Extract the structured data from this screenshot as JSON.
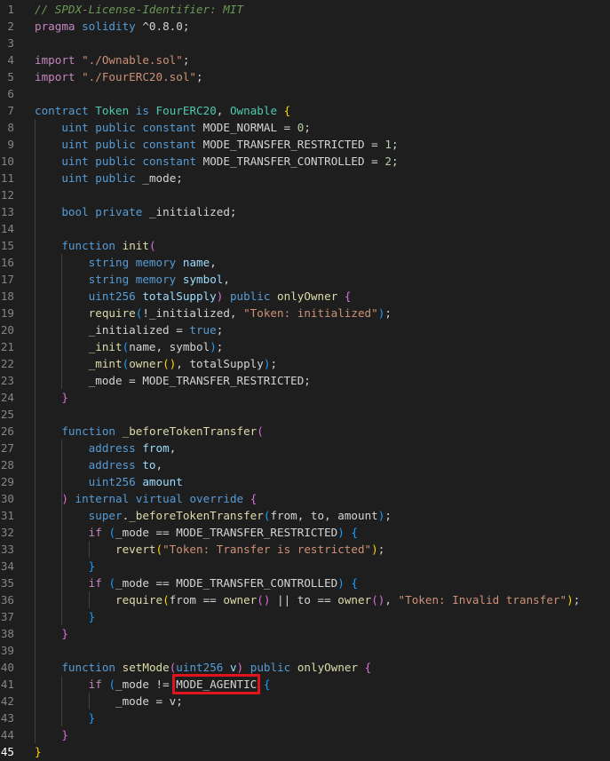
{
  "editor": {
    "language": "solidity",
    "active_line": 45,
    "highlighted_token": "MODE_AGENTIC",
    "highlight_color": "#e0141c",
    "background": "#1e1e1e",
    "lines": [
      {
        "n": "1",
        "tokens": [
          [
            "cm",
            "// SPDX-License-Identifier: MIT"
          ]
        ]
      },
      {
        "n": "2",
        "tokens": [
          [
            "ctl",
            "pragma"
          ],
          [
            "plain",
            " "
          ],
          [
            "kw",
            "solidity"
          ],
          [
            "plain",
            " ^0.8.0;"
          ]
        ]
      },
      {
        "n": "3",
        "tokens": []
      },
      {
        "n": "4",
        "tokens": [
          [
            "ctl",
            "import"
          ],
          [
            "plain",
            " "
          ],
          [
            "str",
            "\"./Ownable.sol\""
          ],
          [
            "plain",
            ";"
          ]
        ]
      },
      {
        "n": "5",
        "tokens": [
          [
            "ctl",
            "import"
          ],
          [
            "plain",
            " "
          ],
          [
            "str",
            "\"./FourERC20.sol\""
          ],
          [
            "plain",
            ";"
          ]
        ]
      },
      {
        "n": "6",
        "tokens": []
      },
      {
        "n": "7",
        "tokens": [
          [
            "kw",
            "contract"
          ],
          [
            "plain",
            " "
          ],
          [
            "ty",
            "Token"
          ],
          [
            "plain",
            " "
          ],
          [
            "kw",
            "is"
          ],
          [
            "plain",
            " "
          ],
          [
            "ty",
            "FourERC20"
          ],
          [
            "plain",
            ", "
          ],
          [
            "ty",
            "Ownable"
          ],
          [
            "plain",
            " "
          ],
          [
            "b1",
            "{"
          ]
        ]
      },
      {
        "n": "8",
        "tokens": [
          [
            "plain",
            "    "
          ],
          [
            "kw",
            "uint"
          ],
          [
            "plain",
            " "
          ],
          [
            "kw",
            "public"
          ],
          [
            "plain",
            " "
          ],
          [
            "kw",
            "constant"
          ],
          [
            "plain",
            " MODE_NORMAL = "
          ],
          [
            "num",
            "0"
          ],
          [
            "plain",
            ";"
          ]
        ]
      },
      {
        "n": "9",
        "tokens": [
          [
            "plain",
            "    "
          ],
          [
            "kw",
            "uint"
          ],
          [
            "plain",
            " "
          ],
          [
            "kw",
            "public"
          ],
          [
            "plain",
            " "
          ],
          [
            "kw",
            "constant"
          ],
          [
            "plain",
            " MODE_TRANSFER_RESTRICTED = "
          ],
          [
            "num",
            "1"
          ],
          [
            "plain",
            ";"
          ]
        ]
      },
      {
        "n": "10",
        "tokens": [
          [
            "plain",
            "    "
          ],
          [
            "kw",
            "uint"
          ],
          [
            "plain",
            " "
          ],
          [
            "kw",
            "public"
          ],
          [
            "plain",
            " "
          ],
          [
            "kw",
            "constant"
          ],
          [
            "plain",
            " MODE_TRANSFER_CONTROLLED = "
          ],
          [
            "num",
            "2"
          ],
          [
            "plain",
            ";"
          ]
        ]
      },
      {
        "n": "11",
        "tokens": [
          [
            "plain",
            "    "
          ],
          [
            "kw",
            "uint"
          ],
          [
            "plain",
            " "
          ],
          [
            "kw",
            "public"
          ],
          [
            "plain",
            " _mode;"
          ]
        ]
      },
      {
        "n": "12",
        "tokens": []
      },
      {
        "n": "13",
        "tokens": [
          [
            "plain",
            "    "
          ],
          [
            "kw",
            "bool"
          ],
          [
            "plain",
            " "
          ],
          [
            "kw",
            "private"
          ],
          [
            "plain",
            " _initialized;"
          ]
        ]
      },
      {
        "n": "14",
        "tokens": []
      },
      {
        "n": "15",
        "tokens": [
          [
            "plain",
            "    "
          ],
          [
            "kw",
            "function"
          ],
          [
            "plain",
            " "
          ],
          [
            "fn",
            "init"
          ],
          [
            "b2",
            "("
          ]
        ]
      },
      {
        "n": "16",
        "tokens": [
          [
            "plain",
            "        "
          ],
          [
            "kw",
            "string"
          ],
          [
            "plain",
            " "
          ],
          [
            "kw",
            "memory"
          ],
          [
            "plain",
            " "
          ],
          [
            "var",
            "name"
          ],
          [
            "plain",
            ","
          ]
        ]
      },
      {
        "n": "17",
        "tokens": [
          [
            "plain",
            "        "
          ],
          [
            "kw",
            "string"
          ],
          [
            "plain",
            " "
          ],
          [
            "kw",
            "memory"
          ],
          [
            "plain",
            " "
          ],
          [
            "var",
            "symbol"
          ],
          [
            "plain",
            ","
          ]
        ]
      },
      {
        "n": "18",
        "tokens": [
          [
            "plain",
            "        "
          ],
          [
            "kw",
            "uint256"
          ],
          [
            "plain",
            " "
          ],
          [
            "var",
            "totalSupply"
          ],
          [
            "b2",
            ")"
          ],
          [
            "plain",
            " "
          ],
          [
            "kw",
            "public"
          ],
          [
            "plain",
            " "
          ],
          [
            "fn",
            "onlyOwner"
          ],
          [
            "plain",
            " "
          ],
          [
            "b2",
            "{"
          ]
        ]
      },
      {
        "n": "19",
        "tokens": [
          [
            "plain",
            "        "
          ],
          [
            "fn",
            "require"
          ],
          [
            "b3",
            "("
          ],
          [
            "plain",
            "!_initialized, "
          ],
          [
            "str",
            "\"Token: initialized\""
          ],
          [
            "b3",
            ")"
          ],
          [
            "plain",
            ";"
          ]
        ]
      },
      {
        "n": "20",
        "tokens": [
          [
            "plain",
            "        _initialized = "
          ],
          [
            "kw",
            "true"
          ],
          [
            "plain",
            ";"
          ]
        ]
      },
      {
        "n": "21",
        "tokens": [
          [
            "plain",
            "        "
          ],
          [
            "fn",
            "_init"
          ],
          [
            "b3",
            "("
          ],
          [
            "plain",
            "name, symbol"
          ],
          [
            "b3",
            ")"
          ],
          [
            "plain",
            ";"
          ]
        ]
      },
      {
        "n": "22",
        "tokens": [
          [
            "plain",
            "        "
          ],
          [
            "fn",
            "_mint"
          ],
          [
            "b3",
            "("
          ],
          [
            "fn",
            "owner"
          ],
          [
            "b1",
            "()"
          ],
          [
            "plain",
            ", totalSupply"
          ],
          [
            "b3",
            ")"
          ],
          [
            "plain",
            ";"
          ]
        ]
      },
      {
        "n": "23",
        "tokens": [
          [
            "plain",
            "        _mode = MODE_TRANSFER_RESTRICTED;"
          ]
        ]
      },
      {
        "n": "24",
        "tokens": [
          [
            "plain",
            "    "
          ],
          [
            "b2",
            "}"
          ]
        ]
      },
      {
        "n": "25",
        "tokens": []
      },
      {
        "n": "26",
        "tokens": [
          [
            "plain",
            "    "
          ],
          [
            "kw",
            "function"
          ],
          [
            "plain",
            " "
          ],
          [
            "fn",
            "_beforeTokenTransfer"
          ],
          [
            "b2",
            "("
          ]
        ]
      },
      {
        "n": "27",
        "tokens": [
          [
            "plain",
            "        "
          ],
          [
            "kw",
            "address"
          ],
          [
            "plain",
            " "
          ],
          [
            "var",
            "from"
          ],
          [
            "plain",
            ","
          ]
        ]
      },
      {
        "n": "28",
        "tokens": [
          [
            "plain",
            "        "
          ],
          [
            "kw",
            "address"
          ],
          [
            "plain",
            " "
          ],
          [
            "var",
            "to"
          ],
          [
            "plain",
            ","
          ]
        ]
      },
      {
        "n": "29",
        "tokens": [
          [
            "plain",
            "        "
          ],
          [
            "kw",
            "uint256"
          ],
          [
            "plain",
            " "
          ],
          [
            "var",
            "amount"
          ]
        ]
      },
      {
        "n": "30",
        "tokens": [
          [
            "plain",
            "    "
          ],
          [
            "b2",
            ")"
          ],
          [
            "plain",
            " "
          ],
          [
            "kw",
            "internal"
          ],
          [
            "plain",
            " "
          ],
          [
            "kw",
            "virtual"
          ],
          [
            "plain",
            " "
          ],
          [
            "kw",
            "override"
          ],
          [
            "plain",
            " "
          ],
          [
            "b2",
            "{"
          ]
        ]
      },
      {
        "n": "31",
        "tokens": [
          [
            "plain",
            "        "
          ],
          [
            "kw",
            "super"
          ],
          [
            "plain",
            "."
          ],
          [
            "fn",
            "_beforeTokenTransfer"
          ],
          [
            "b3",
            "("
          ],
          [
            "plain",
            "from, to, amount"
          ],
          [
            "b3",
            ")"
          ],
          [
            "plain",
            ";"
          ]
        ]
      },
      {
        "n": "32",
        "tokens": [
          [
            "plain",
            "        "
          ],
          [
            "ctl",
            "if"
          ],
          [
            "plain",
            " "
          ],
          [
            "b3",
            "("
          ],
          [
            "plain",
            "_mode == MODE_TRANSFER_RESTRICTED"
          ],
          [
            "b3",
            ")"
          ],
          [
            "plain",
            " "
          ],
          [
            "b3",
            "{"
          ]
        ]
      },
      {
        "n": "33",
        "tokens": [
          [
            "plain",
            "            "
          ],
          [
            "fn",
            "revert"
          ],
          [
            "b1",
            "("
          ],
          [
            "str",
            "\"Token: Transfer is restricted\""
          ],
          [
            "b1",
            ")"
          ],
          [
            "plain",
            ";"
          ]
        ]
      },
      {
        "n": "34",
        "tokens": [
          [
            "plain",
            "        "
          ],
          [
            "b3",
            "}"
          ]
        ]
      },
      {
        "n": "35",
        "tokens": [
          [
            "plain",
            "        "
          ],
          [
            "ctl",
            "if"
          ],
          [
            "plain",
            " "
          ],
          [
            "b3",
            "("
          ],
          [
            "plain",
            "_mode == MODE_TRANSFER_CONTROLLED"
          ],
          [
            "b3",
            ")"
          ],
          [
            "plain",
            " "
          ],
          [
            "b3",
            "{"
          ]
        ]
      },
      {
        "n": "36",
        "tokens": [
          [
            "plain",
            "            "
          ],
          [
            "fn",
            "require"
          ],
          [
            "b1",
            "("
          ],
          [
            "plain",
            "from == "
          ],
          [
            "fn",
            "owner"
          ],
          [
            "b2",
            "()"
          ],
          [
            "plain",
            " || to == "
          ],
          [
            "fn",
            "owner"
          ],
          [
            "b2",
            "()"
          ],
          [
            "plain",
            ", "
          ],
          [
            "str",
            "\"Token: Invalid transfer\""
          ],
          [
            "b1",
            ")"
          ],
          [
            "plain",
            ";"
          ]
        ]
      },
      {
        "n": "37",
        "tokens": [
          [
            "plain",
            "        "
          ],
          [
            "b3",
            "}"
          ]
        ]
      },
      {
        "n": "38",
        "tokens": [
          [
            "plain",
            "    "
          ],
          [
            "b2",
            "}"
          ]
        ]
      },
      {
        "n": "39",
        "tokens": []
      },
      {
        "n": "40",
        "tokens": [
          [
            "plain",
            "    "
          ],
          [
            "kw",
            "function"
          ],
          [
            "plain",
            " "
          ],
          [
            "fn",
            "setMode"
          ],
          [
            "b2",
            "("
          ],
          [
            "kw",
            "uint256"
          ],
          [
            "plain",
            " "
          ],
          [
            "var",
            "v"
          ],
          [
            "b2",
            ")"
          ],
          [
            "plain",
            " "
          ],
          [
            "kw",
            "public"
          ],
          [
            "plain",
            " "
          ],
          [
            "fn",
            "onlyOwner"
          ],
          [
            "plain",
            " "
          ],
          [
            "b2",
            "{"
          ]
        ]
      },
      {
        "n": "41",
        "tokens": [
          [
            "plain",
            "        "
          ],
          [
            "ctl",
            "if"
          ],
          [
            "plain",
            " "
          ],
          [
            "b3",
            "("
          ],
          [
            "plain",
            "_mode != "
          ],
          [
            "hl",
            "MODE_AGENTIC"
          ],
          [
            "plain",
            " "
          ],
          [
            "b3",
            "{"
          ]
        ]
      },
      {
        "n": "42",
        "tokens": [
          [
            "plain",
            "            _mode = v;"
          ]
        ]
      },
      {
        "n": "43",
        "tokens": [
          [
            "plain",
            "        "
          ],
          [
            "b3",
            "}"
          ]
        ]
      },
      {
        "n": "44",
        "tokens": [
          [
            "plain",
            "    "
          ],
          [
            "b2",
            "}"
          ]
        ]
      },
      {
        "n": "45",
        "tokens": [
          [
            "b1",
            "}"
          ]
        ]
      }
    ]
  }
}
